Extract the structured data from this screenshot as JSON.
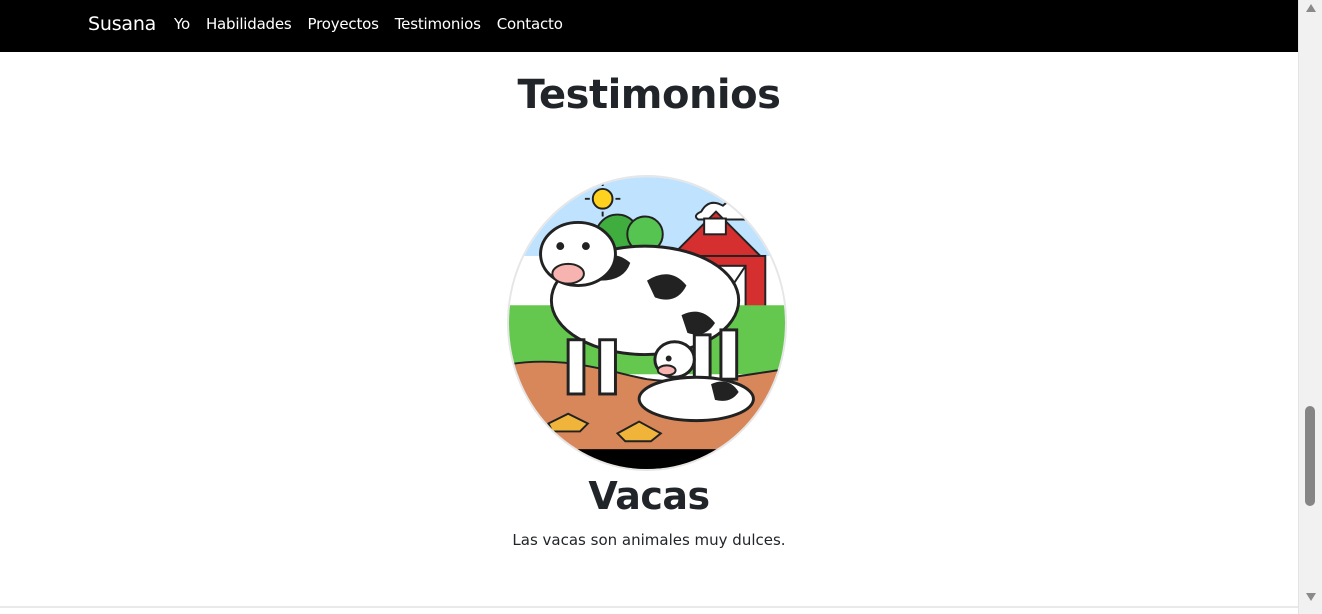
{
  "nav": {
    "brand": "Susana",
    "links": [
      {
        "label": "Yo"
      },
      {
        "label": "Habilidades"
      },
      {
        "label": "Proyectos"
      },
      {
        "label": "Testimonios"
      },
      {
        "label": "Contacto"
      }
    ]
  },
  "testimonials": {
    "title": "Testimonios",
    "card": {
      "name": "Vacas",
      "text": "Las vacas son animales muy dulces.",
      "image_alt": "cows-illustration"
    }
  },
  "colors": {
    "navbar_bg": "#000000",
    "nav_text": "#ffffff",
    "heading": "#212529"
  }
}
